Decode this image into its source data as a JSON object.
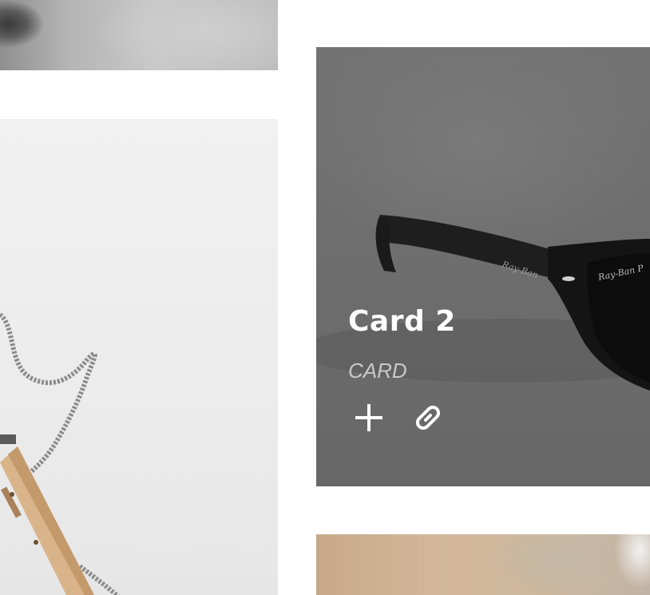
{
  "cards": [
    {
      "title": "Card 2",
      "category": "CARD",
      "actions": [
        {
          "icon": "plus-icon"
        },
        {
          "icon": "link-icon"
        }
      ]
    }
  ],
  "colors": {
    "overlay": "#6e6e6e",
    "title": "#ffffff",
    "category": "#c9c9c9",
    "background": "#ffffff"
  }
}
